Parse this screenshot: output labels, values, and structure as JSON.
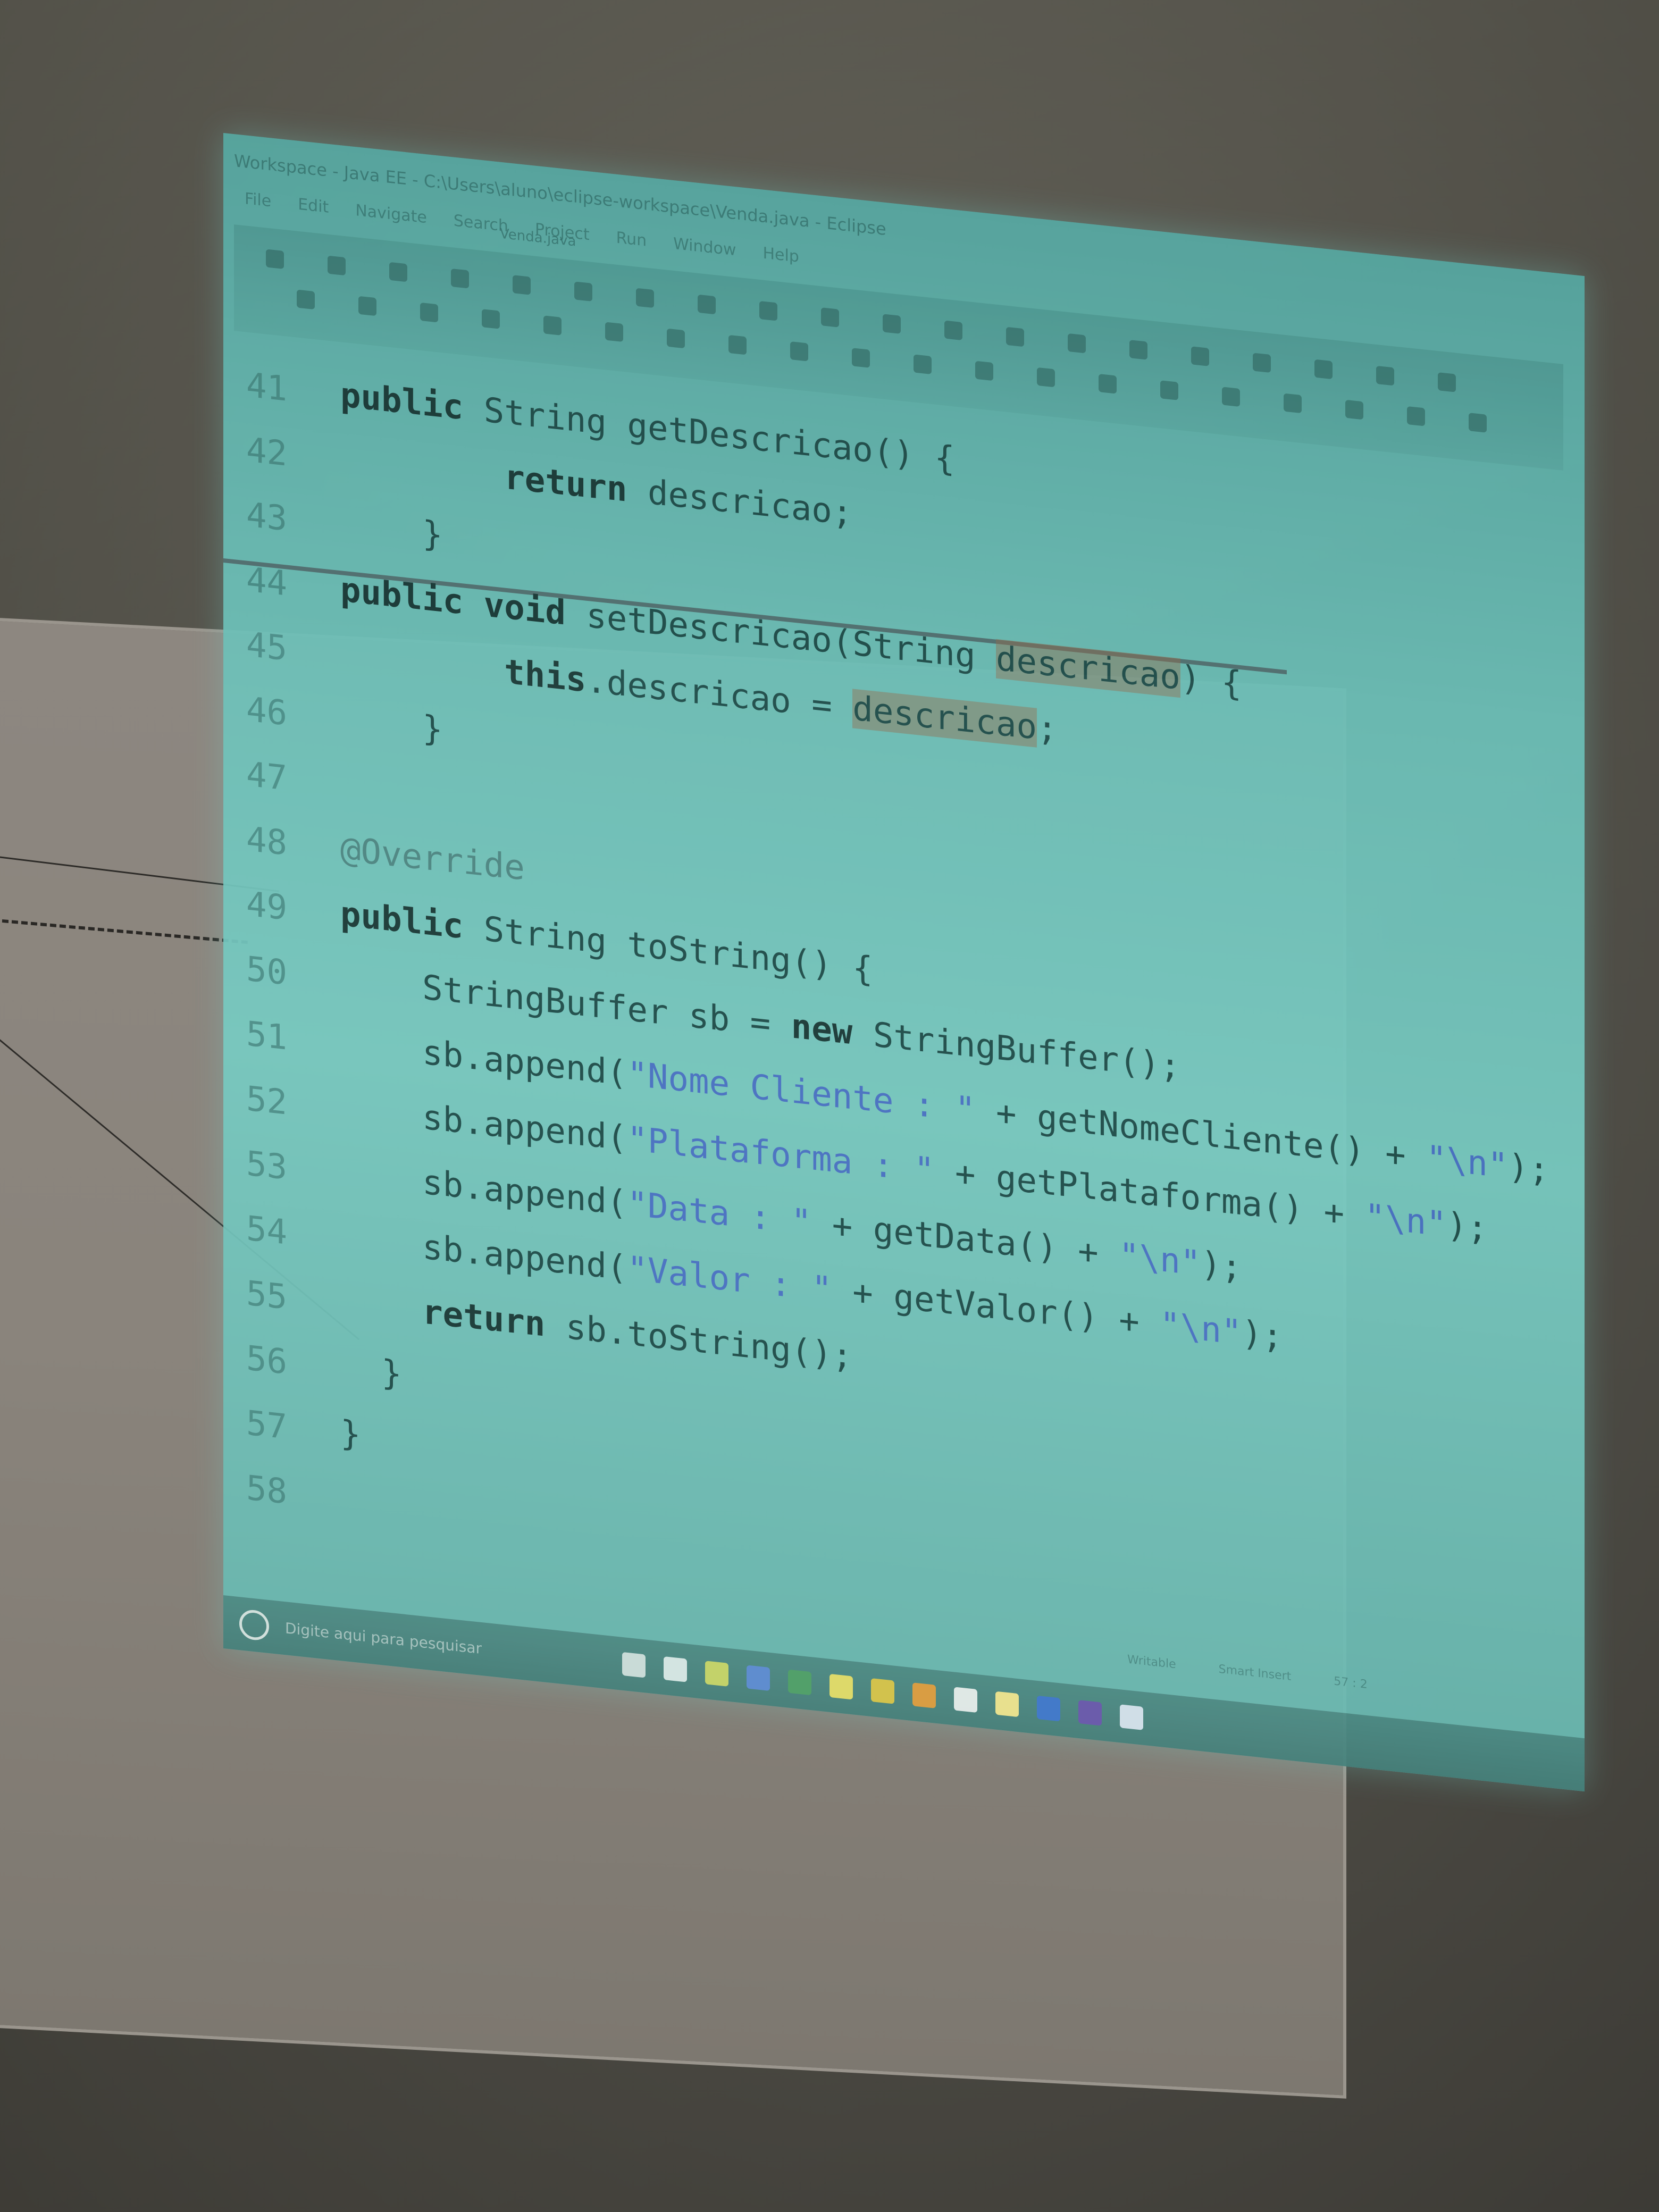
{
  "window": {
    "title": "Workspace - Java EE - C:\\Users\\aluno\\eclipse-workspace\\Venda.java - Eclipse",
    "menu": [
      "File",
      "Edit",
      "Navigate",
      "Search",
      "Project",
      "Run",
      "Window",
      "Help"
    ],
    "editor_tab": "Venda.java"
  },
  "code_lines": [
    {
      "num": "41",
      "tokens": [
        {
          "t": "public",
          "c": "kw"
        },
        {
          "t": " String getDescricao() {",
          "c": ""
        }
      ]
    },
    {
      "num": "42",
      "tokens": [
        {
          "t": "        return",
          "c": "kw"
        },
        {
          "t": " descricao;",
          "c": ""
        }
      ]
    },
    {
      "num": "43",
      "tokens": [
        {
          "t": "    }",
          "c": ""
        }
      ]
    },
    {
      "num": "44",
      "tokens": [
        {
          "t": "public void",
          "c": "kw"
        },
        {
          "t": " setDescricao(String ",
          "c": ""
        },
        {
          "t": "descricao",
          "c": "hl"
        },
        {
          "t": ") {",
          "c": ""
        }
      ]
    },
    {
      "num": "45",
      "tokens": [
        {
          "t": "        this",
          "c": "kw"
        },
        {
          "t": ".descricao = ",
          "c": ""
        },
        {
          "t": "descricao",
          "c": "hl"
        },
        {
          "t": ";",
          "c": ""
        }
      ]
    },
    {
      "num": "46",
      "tokens": [
        {
          "t": "    }",
          "c": ""
        }
      ]
    },
    {
      "num": "47",
      "tokens": []
    },
    {
      "num": "48",
      "tokens": [
        {
          "t": "@Override",
          "c": "ann"
        }
      ]
    },
    {
      "num": "49",
      "tokens": [
        {
          "t": "public",
          "c": "kw"
        },
        {
          "t": " String toString() {",
          "c": ""
        }
      ]
    },
    {
      "num": "50",
      "tokens": [
        {
          "t": "    StringBuffer sb = ",
          "c": ""
        },
        {
          "t": "new",
          "c": "kw"
        },
        {
          "t": " StringBuffer();",
          "c": ""
        }
      ]
    },
    {
      "num": "51",
      "tokens": [
        {
          "t": "    sb.append(",
          "c": ""
        },
        {
          "t": "\"Nome Cliente : \"",
          "c": "str"
        },
        {
          "t": " + getNomeCliente() + ",
          "c": ""
        },
        {
          "t": "\"\\n\"",
          "c": "str"
        },
        {
          "t": ");",
          "c": ""
        }
      ]
    },
    {
      "num": "52",
      "tokens": [
        {
          "t": "    sb.append(",
          "c": ""
        },
        {
          "t": "\"Plataforma : \"",
          "c": "str"
        },
        {
          "t": " + getPlataforma() + ",
          "c": ""
        },
        {
          "t": "\"\\n\"",
          "c": "str"
        },
        {
          "t": ");",
          "c": ""
        }
      ]
    },
    {
      "num": "53",
      "tokens": [
        {
          "t": "    sb.append(",
          "c": ""
        },
        {
          "t": "\"Data : \"",
          "c": "str"
        },
        {
          "t": " + getData() + ",
          "c": ""
        },
        {
          "t": "\"\\n\"",
          "c": "str"
        },
        {
          "t": ");",
          "c": ""
        }
      ]
    },
    {
      "num": "54",
      "tokens": [
        {
          "t": "    sb.append(",
          "c": ""
        },
        {
          "t": "\"Valor : \"",
          "c": "str"
        },
        {
          "t": " + getValor() + ",
          "c": ""
        },
        {
          "t": "\"\\n\"",
          "c": "str"
        },
        {
          "t": ");",
          "c": ""
        }
      ]
    },
    {
      "num": "55",
      "tokens": [
        {
          "t": "    ",
          "c": ""
        },
        {
          "t": "return",
          "c": "kw"
        },
        {
          "t": " sb.toString();",
          "c": ""
        }
      ]
    },
    {
      "num": "56",
      "tokens": [
        {
          "t": "  }",
          "c": ""
        }
      ]
    },
    {
      "num": "57",
      "tokens": [
        {
          "t": "}",
          "c": ""
        }
      ]
    },
    {
      "num": "58",
      "tokens": []
    }
  ],
  "status": [
    "Writable",
    "Smart Insert",
    "57 : 2"
  ],
  "taskbar": {
    "search_placeholder": "Digite aqui para pesquisar",
    "icons": [
      {
        "name": "task-view-icon",
        "color": "#cfe3df"
      },
      {
        "name": "search-icon",
        "color": "#d9ecea"
      },
      {
        "name": "file-explorer-icon",
        "color": "#c8d96a"
      },
      {
        "name": "store-icon",
        "color": "#5d8fd6"
      },
      {
        "name": "excel-icon",
        "color": "#4fa36a"
      },
      {
        "name": "notes-icon",
        "color": "#e4e06a"
      },
      {
        "name": "chrome-icon",
        "color": "#d8c84a"
      },
      {
        "name": "firefox-icon",
        "color": "#e0a040"
      },
      {
        "name": "settings-icon",
        "color": "#e6f0ee"
      },
      {
        "name": "notepad-icon",
        "color": "#f0e890"
      },
      {
        "name": "vscode-icon",
        "color": "#3f7ad0"
      },
      {
        "name": "eclipse-icon",
        "color": "#6a5ab0"
      },
      {
        "name": "app-icon",
        "color": "#d6e6f0"
      }
    ]
  }
}
